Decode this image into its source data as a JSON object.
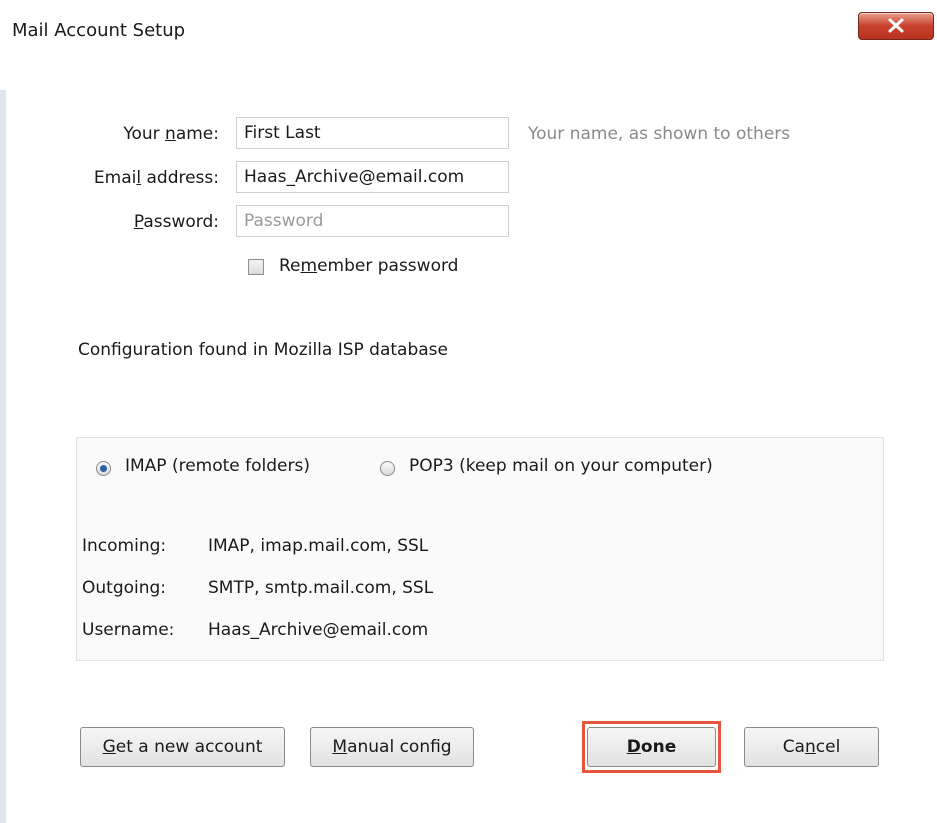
{
  "window": {
    "title": "Mail Account Setup",
    "close_label": "X"
  },
  "form": {
    "name_label_pre": "Your ",
    "name_label_u": "n",
    "name_label_post": "ame:",
    "name_value": "First Last",
    "name_hint": "Your name, as shown to others",
    "email_label_pre": "Emai",
    "email_label_u": "l",
    "email_label_post": " address:",
    "email_value": "Haas_Archive@email.com",
    "password_label_u": "P",
    "password_label_post": "assword:",
    "password_placeholder": "Password",
    "remember_pre": "Re",
    "remember_u": "m",
    "remember_post": "ember password",
    "remember_checked": false
  },
  "config": {
    "status_text": "Configuration found in Mozilla ISP database",
    "protocol_options": [
      {
        "label": "IMAP (remote folders)",
        "selected": true
      },
      {
        "label": "POP3 (keep mail on your computer)",
        "selected": false
      }
    ],
    "incoming_label": "Incoming:",
    "incoming_value": "IMAP, imap.mail.com, SSL",
    "outgoing_label": "Outgoing:",
    "outgoing_value": "SMTP, smtp.mail.com, SSL",
    "username_label": "Username:",
    "username_value": "Haas_Archive@email.com"
  },
  "buttons": {
    "get_account_u": "G",
    "get_account_post": "et a new account",
    "manual_u": "M",
    "manual_post": "anual config",
    "done_u": "D",
    "done_post": "one",
    "cancel_pre": "Ca",
    "cancel_u": "n",
    "cancel_post": "cel"
  },
  "colors": {
    "highlight": "#e8553c",
    "close_button": "#c9412b",
    "radio_selected": "#2b5fa6"
  }
}
